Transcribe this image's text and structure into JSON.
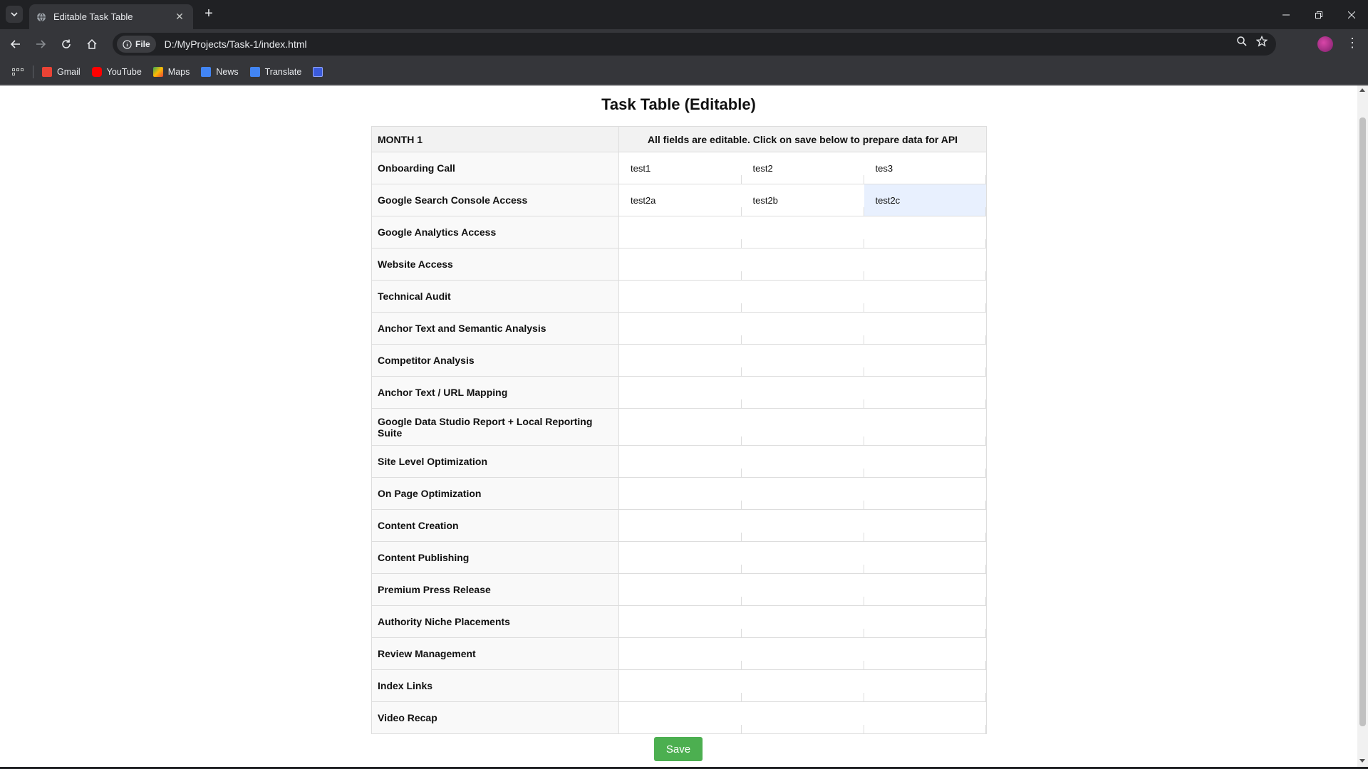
{
  "browser": {
    "tab_title": "Editable Task Table",
    "url_chip": "File",
    "url": "D:/MyProjects/Task-1/index.html",
    "bookmarks": [
      {
        "label": "Gmail",
        "color": "#ea4335"
      },
      {
        "label": "YouTube",
        "color": "#ff0000"
      },
      {
        "label": "Maps",
        "color": "#34a853"
      },
      {
        "label": "News",
        "color": "#4285f4"
      },
      {
        "label": "Translate",
        "color": "#4285f4"
      }
    ]
  },
  "page": {
    "title": "Task Table (Editable)",
    "header": {
      "month": "MONTH 1",
      "note": "All fields are editable. Click on save below to prepare data for API"
    },
    "rows": [
      {
        "task": "Onboarding Call",
        "values": [
          "test1",
          "test2",
          "tes3"
        ]
      },
      {
        "task": "Google Search Console Access",
        "values": [
          "test2a",
          "test2b",
          "test2c"
        ]
      },
      {
        "task": "Google Analytics Access",
        "values": [
          "",
          "",
          ""
        ]
      },
      {
        "task": "Website Access",
        "values": [
          "",
          "",
          ""
        ]
      },
      {
        "task": "Technical Audit",
        "values": [
          "",
          "",
          ""
        ]
      },
      {
        "task": "Anchor Text and Semantic Analysis",
        "values": [
          "",
          "",
          ""
        ]
      },
      {
        "task": "Competitor Analysis",
        "values": [
          "",
          "",
          ""
        ]
      },
      {
        "task": "Anchor Text / URL Mapping",
        "values": [
          "",
          "",
          ""
        ]
      },
      {
        "task": "Google Data Studio Report + Local Reporting Suite",
        "values": [
          "",
          "",
          ""
        ]
      },
      {
        "task": "Site Level Optimization",
        "values": [
          "",
          "",
          ""
        ]
      },
      {
        "task": "On Page Optimization",
        "values": [
          "",
          "",
          ""
        ]
      },
      {
        "task": "Content Creation",
        "values": [
          "",
          "",
          ""
        ]
      },
      {
        "task": "Content Publishing",
        "values": [
          "",
          "",
          ""
        ]
      },
      {
        "task": "Premium Press Release",
        "values": [
          "",
          "",
          ""
        ]
      },
      {
        "task": "Authority Niche Placements",
        "values": [
          "",
          "",
          ""
        ]
      },
      {
        "task": "Review Management",
        "values": [
          "",
          "",
          ""
        ]
      },
      {
        "task": "Index Links",
        "values": [
          "",
          "",
          ""
        ]
      },
      {
        "task": "Video Recap",
        "values": [
          "",
          "",
          ""
        ]
      }
    ],
    "focused_cell": {
      "row": 1,
      "col": 2
    },
    "save_label": "Save",
    "save_color": "#4caf50"
  }
}
